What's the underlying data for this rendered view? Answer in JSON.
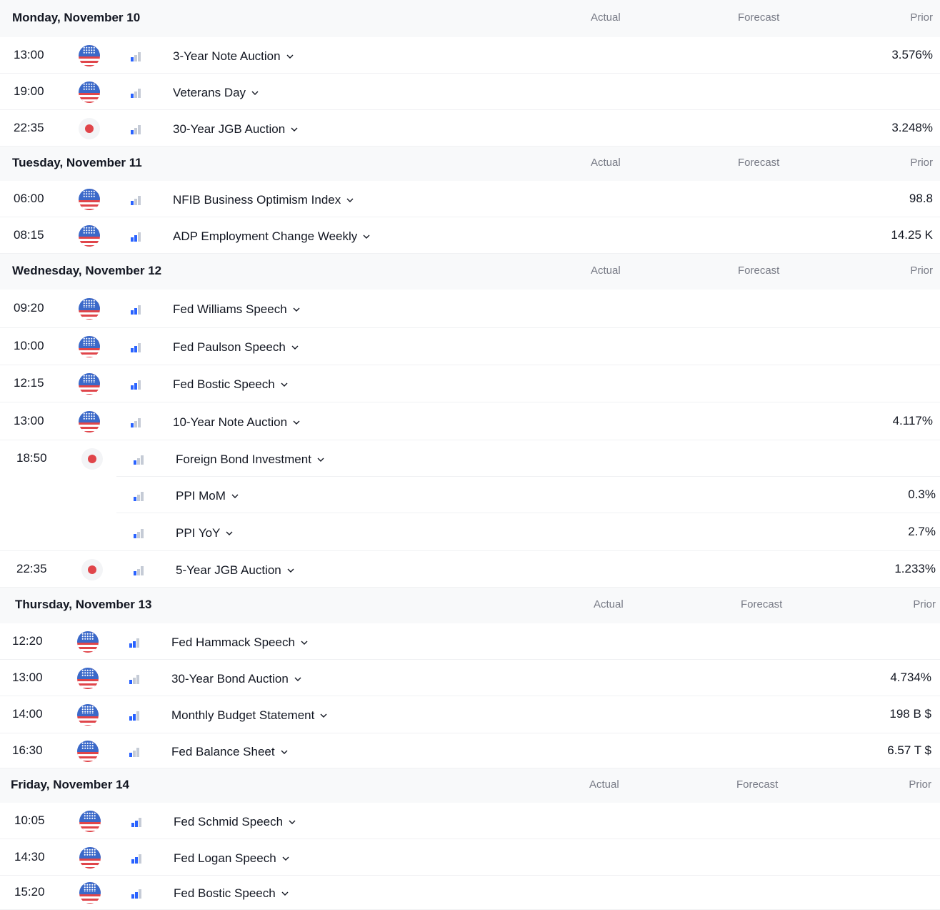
{
  "columns": {
    "actual": "Actual",
    "forecast": "Forecast",
    "prior": "Prior"
  },
  "colors": {
    "us_blue": "#3b69c9",
    "jp_red": "#e0454a",
    "importance_active": "#2962ff",
    "importance_inactive": "#c5cbd6"
  },
  "days": [
    {
      "title": "Monday, November 10",
      "events": [
        {
          "time": "13:00",
          "country": "us",
          "importance": 1,
          "title": "3-Year Note Auction",
          "prior": "3.576%"
        },
        {
          "time": "19:00",
          "country": "us",
          "importance": 1,
          "title": "Veterans Day",
          "prior": ""
        },
        {
          "time": "22:35",
          "country": "jp",
          "importance": 1,
          "title": "30-Year JGB Auction",
          "prior": "3.248%"
        }
      ]
    },
    {
      "title": "Tuesday, November 11",
      "events": [
        {
          "time": "06:00",
          "country": "us",
          "importance": 1,
          "title": "NFIB Business Optimism Index",
          "prior": "98.8"
        },
        {
          "time": "08:15",
          "country": "us",
          "importance": 2,
          "title": "ADP Employment Change Weekly",
          "prior": "14.25 K"
        }
      ]
    },
    {
      "title": "Wednesday, November 12",
      "events": [
        {
          "time": "09:20",
          "country": "us",
          "importance": 2,
          "title": "Fed Williams Speech",
          "prior": ""
        },
        {
          "time": "10:00",
          "country": "us",
          "importance": 2,
          "title": "Fed Paulson Speech",
          "prior": ""
        },
        {
          "time": "12:15",
          "country": "us",
          "importance": 2,
          "title": "Fed Bostic Speech",
          "prior": ""
        },
        {
          "time": "13:00",
          "country": "us",
          "importance": 1,
          "title": "10-Year Note Auction",
          "prior": "4.117%"
        },
        {
          "time": "18:50",
          "country": "jp",
          "importance": 1,
          "title": "Foreign Bond Investment",
          "prior": ""
        },
        {
          "time": "",
          "country": "",
          "importance": 1,
          "title": "PPI MoM",
          "prior": "0.3%"
        },
        {
          "time": "",
          "country": "",
          "importance": 1,
          "title": "PPI YoY",
          "prior": "2.7%"
        },
        {
          "time": "22:35",
          "country": "jp",
          "importance": 1,
          "title": "5-Year JGB Auction",
          "prior": "1.233%"
        }
      ]
    },
    {
      "title": "Thursday, November 13",
      "events": [
        {
          "time": "12:20",
          "country": "us",
          "importance": 2,
          "title": "Fed Hammack Speech",
          "prior": ""
        },
        {
          "time": "13:00",
          "country": "us",
          "importance": 1,
          "title": "30-Year Bond Auction",
          "prior": "4.734%"
        },
        {
          "time": "14:00",
          "country": "us",
          "importance": 2,
          "title": "Monthly Budget Statement",
          "prior": "198 B $"
        },
        {
          "time": "16:30",
          "country": "us",
          "importance": 1,
          "title": "Fed Balance Sheet",
          "prior": "6.57 T $"
        }
      ]
    },
    {
      "title": "Friday, November 14",
      "events": [
        {
          "time": "10:05",
          "country": "us",
          "importance": 2,
          "title": "Fed Schmid Speech",
          "prior": ""
        },
        {
          "time": "14:30",
          "country": "us",
          "importance": 2,
          "title": "Fed Logan Speech",
          "prior": ""
        },
        {
          "time": "15:20",
          "country": "us",
          "importance": 2,
          "title": "Fed Bostic Speech",
          "prior": ""
        }
      ]
    }
  ]
}
